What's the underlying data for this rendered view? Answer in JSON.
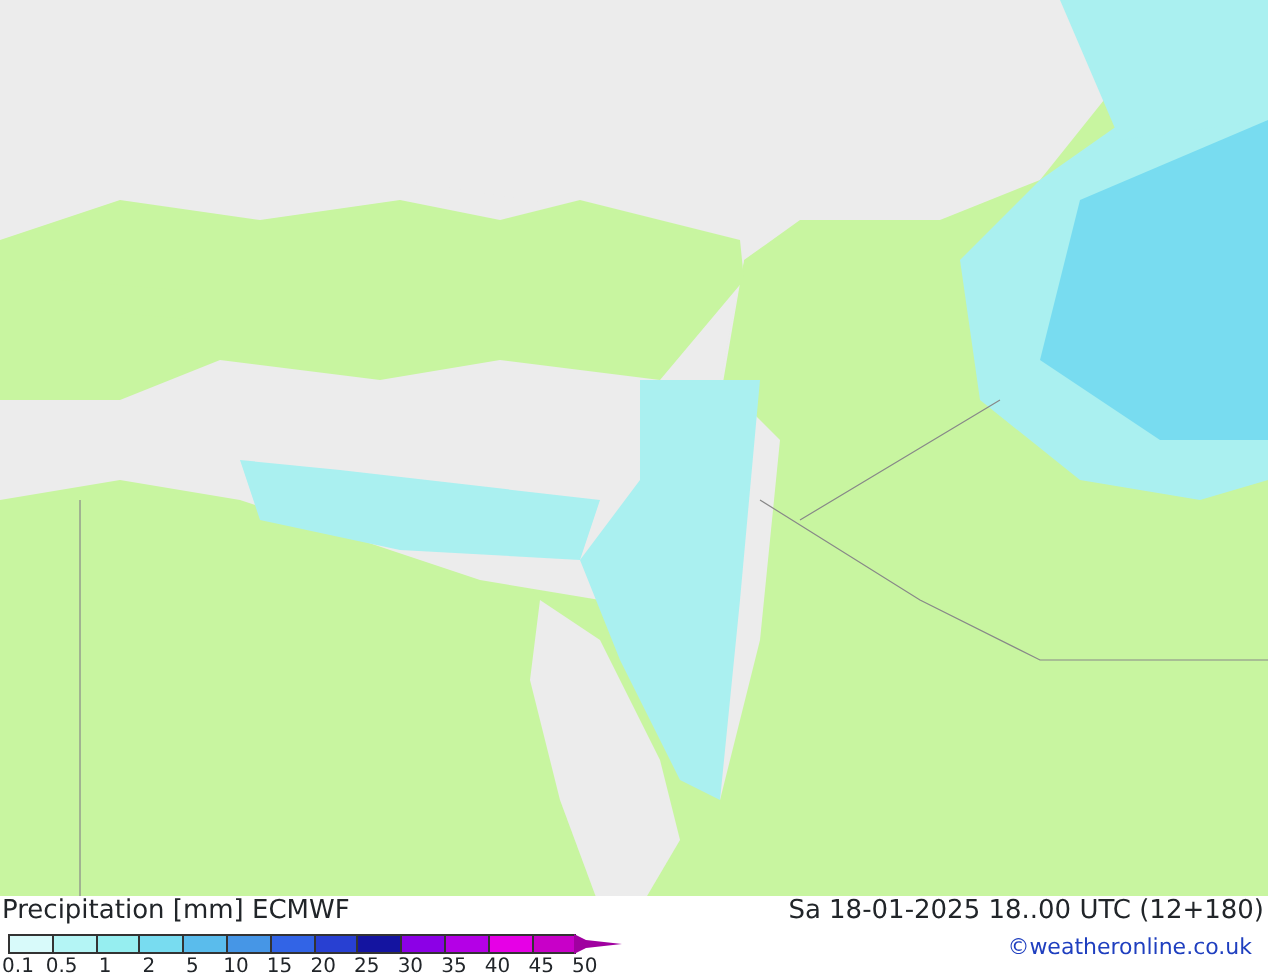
{
  "legend": {
    "title": "Precipitation [mm]",
    "model": "ECMWF",
    "swatches": [
      {
        "color": "#d8fafa"
      },
      {
        "color": "#b4f5f5"
      },
      {
        "color": "#96eef0"
      },
      {
        "color": "#78dcf0"
      },
      {
        "color": "#5abcec"
      },
      {
        "color": "#4696e6"
      },
      {
        "color": "#3264e6"
      },
      {
        "color": "#2840d2"
      },
      {
        "color": "#1414a0"
      },
      {
        "color": "#8c00e6"
      },
      {
        "color": "#b400e6"
      },
      {
        "color": "#e600e6"
      },
      {
        "color": "#c800c8"
      }
    ],
    "labels": [
      "0.1",
      "0.5",
      "1",
      "2",
      "5",
      "10",
      "15",
      "20",
      "25",
      "30",
      "35",
      "40",
      "45",
      "50"
    ]
  },
  "timestamp": "Sa 18-01-2025 18..00 UTC (12+180)",
  "credit": "©weatheronline.co.uk"
}
